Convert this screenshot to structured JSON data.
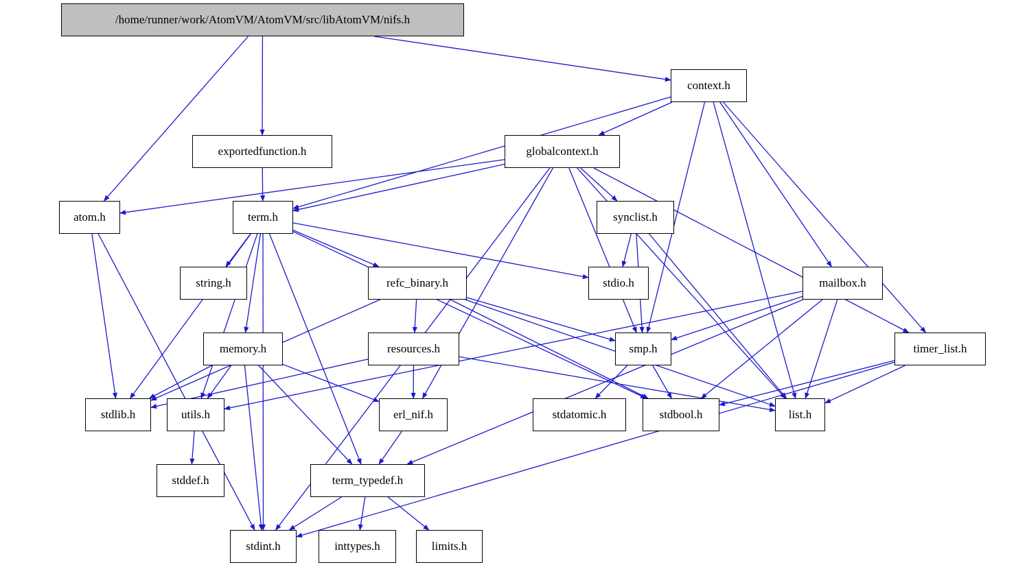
{
  "graph": {
    "edge_color": "#1a1acd",
    "root_fill": "#bfbfbf",
    "nodes": {
      "nifs": "/home/runner/work/AtomVM/AtomVM/src/libAtomVM/nifs.h",
      "context": "context.h",
      "exportedfunction": "exportedfunction.h",
      "globalcontext": "globalcontext.h",
      "atom": "atom.h",
      "term": "term.h",
      "synclist": "synclist.h",
      "string": "string.h",
      "refc_binary": "refc_binary.h",
      "stdio": "stdio.h",
      "mailbox": "mailbox.h",
      "memory": "memory.h",
      "resources": "resources.h",
      "smp": "smp.h",
      "timer_list": "timer_list.h",
      "stdlib": "stdlib.h",
      "utils": "utils.h",
      "erl_nif": "erl_nif.h",
      "stdatomic": "stdatomic.h",
      "stdbool": "stdbool.h",
      "list": "list.h",
      "stddef": "stddef.h",
      "term_typedef": "term_typedef.h",
      "stdint": "stdint.h",
      "inttypes": "inttypes.h",
      "limits": "limits.h"
    },
    "edges": [
      [
        "nifs",
        "atom"
      ],
      [
        "nifs",
        "exportedfunction"
      ],
      [
        "nifs",
        "context"
      ],
      [
        "context",
        "term"
      ],
      [
        "context",
        "globalcontext"
      ],
      [
        "context",
        "smp"
      ],
      [
        "context",
        "mailbox"
      ],
      [
        "context",
        "timer_list"
      ],
      [
        "context",
        "list"
      ],
      [
        "exportedfunction",
        "term"
      ],
      [
        "globalcontext",
        "atom"
      ],
      [
        "globalcontext",
        "term"
      ],
      [
        "globalcontext",
        "stdint"
      ],
      [
        "globalcontext",
        "erl_nif"
      ],
      [
        "globalcontext",
        "smp"
      ],
      [
        "globalcontext",
        "synclist"
      ],
      [
        "globalcontext",
        "list"
      ],
      [
        "globalcontext",
        "timer_list"
      ],
      [
        "atom",
        "stdlib"
      ],
      [
        "atom",
        "stdint"
      ],
      [
        "term",
        "string"
      ],
      [
        "term",
        "stdlib"
      ],
      [
        "term",
        "utils"
      ],
      [
        "term",
        "memory"
      ],
      [
        "term",
        "term_typedef"
      ],
      [
        "term",
        "refc_binary"
      ],
      [
        "term",
        "stdio"
      ],
      [
        "term",
        "stdbool"
      ],
      [
        "term",
        "stdint"
      ],
      [
        "synclist",
        "stdio"
      ],
      [
        "synclist",
        "smp"
      ],
      [
        "synclist",
        "list"
      ],
      [
        "refc_binary",
        "stdlib"
      ],
      [
        "refc_binary",
        "resources"
      ],
      [
        "refc_binary",
        "smp"
      ],
      [
        "refc_binary",
        "stdbool"
      ],
      [
        "refc_binary",
        "list"
      ],
      [
        "mailbox",
        "smp"
      ],
      [
        "mailbox",
        "utils"
      ],
      [
        "mailbox",
        "stdbool"
      ],
      [
        "mailbox",
        "list"
      ],
      [
        "mailbox",
        "term_typedef"
      ],
      [
        "memory",
        "stdlib"
      ],
      [
        "memory",
        "utils"
      ],
      [
        "memory",
        "erl_nif"
      ],
      [
        "memory",
        "term_typedef"
      ],
      [
        "memory",
        "stdint"
      ],
      [
        "resources",
        "stdlib"
      ],
      [
        "resources",
        "erl_nif"
      ],
      [
        "resources",
        "list"
      ],
      [
        "smp",
        "stdatomic"
      ],
      [
        "smp",
        "stdbool"
      ],
      [
        "timer_list",
        "stdbool"
      ],
      [
        "timer_list",
        "list"
      ],
      [
        "timer_list",
        "stdint"
      ],
      [
        "utils",
        "stddef"
      ],
      [
        "erl_nif",
        "term_typedef"
      ],
      [
        "term_typedef",
        "stdint"
      ],
      [
        "term_typedef",
        "inttypes"
      ],
      [
        "term_typedef",
        "limits"
      ]
    ]
  }
}
